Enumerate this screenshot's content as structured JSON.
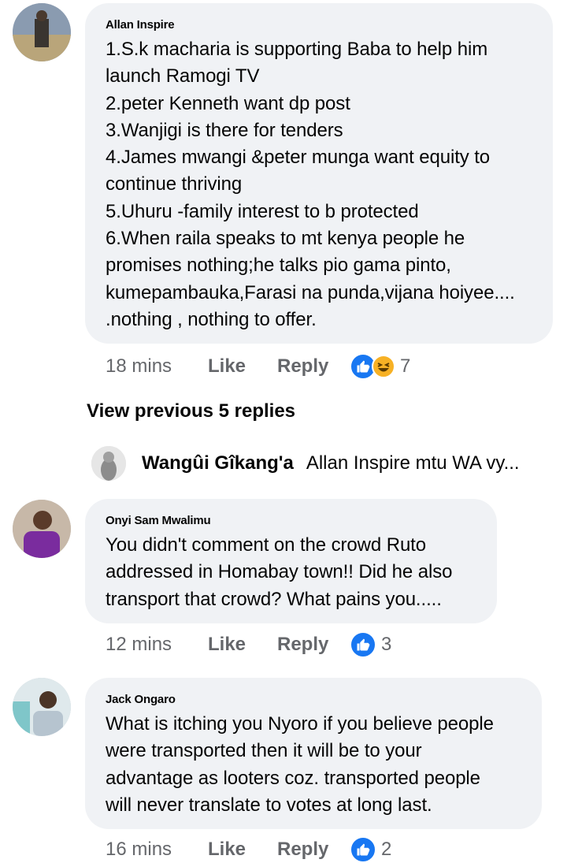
{
  "comments": [
    {
      "author": "Allan Inspire",
      "lines": [
        "1.S.k macharia is supporting Baba to help him",
        "launch Ramogi TV",
        "2.peter Kenneth want dp post",
        "3.Wanjigi is there for tenders",
        "4.James mwangi &peter munga want equity to",
        "continue thriving",
        "5.Uhuru -family interest to b protected",
        "6.When raila speaks to mt kenya people he",
        "promises nothing;he talks pio gama pinto,",
        "kumepambauka,Farasi na punda,vijana hoiyee....",
        ".nothing , nothing to offer."
      ],
      "time": "18 mins",
      "like_label": "Like",
      "reply_label": "Reply",
      "reaction_count": "7",
      "reactions": [
        "like-icon",
        "haha-icon"
      ]
    },
    {
      "author": "Onyi Sam Mwalimu",
      "lines": [
        "You didn't comment on the crowd Ruto",
        "addressed in Homabay town!! Did he also",
        "transport that crowd? What pains you....."
      ],
      "time": "12 mins",
      "like_label": "Like",
      "reply_label": "Reply",
      "reaction_count": "3",
      "reactions": [
        "like-icon"
      ]
    },
    {
      "author": "Jack Ongaro",
      "lines": [
        "What is itching you Nyoro if you believe people",
        "were transported then it will be to your",
        "advantage as looters coz. transported people",
        "will never translate to votes at long last."
      ],
      "time": "16 mins",
      "like_label": "Like",
      "reply_label": "Reply",
      "reaction_count": "2",
      "reactions": [
        "like-icon"
      ]
    }
  ],
  "thread": {
    "view_previous_label": "View previous 5 replies",
    "reply_preview": {
      "author": "Wangûi Gîkang'a",
      "text": "Allan Inspire mtu WA vy..."
    }
  },
  "colors": {
    "bubble": "#f0f2f5",
    "meta_text": "#65676b",
    "like_blue": "#1877f2",
    "haha_yellow": "#f7b125"
  }
}
